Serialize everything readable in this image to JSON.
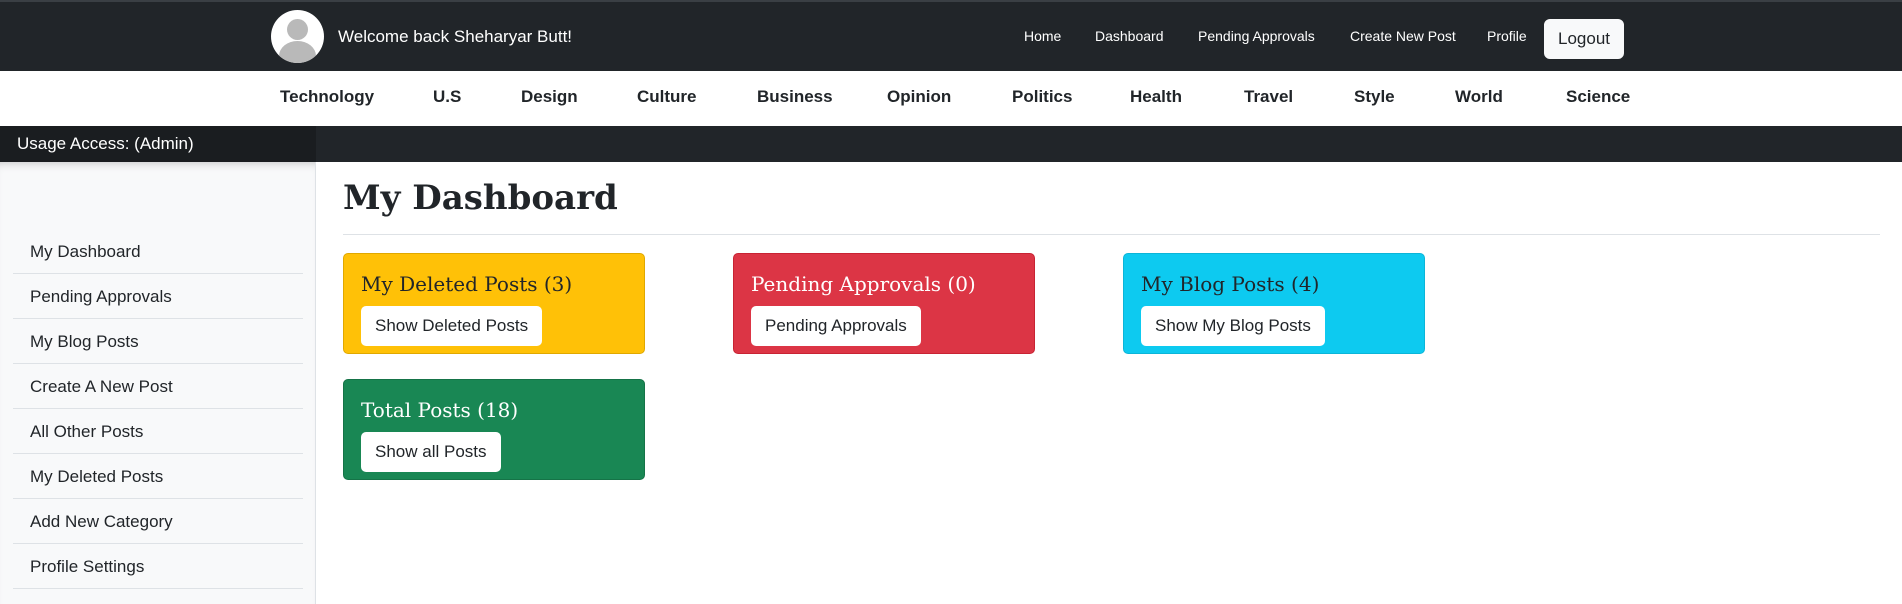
{
  "header": {
    "welcome": "Welcome back Sheharyar Butt!",
    "nav": [
      "Home",
      "Dashboard",
      "Pending Approvals",
      "Create New Post",
      "Profile"
    ],
    "logout": "Logout"
  },
  "categories": [
    "Technology",
    "U.S",
    "Design",
    "Culture",
    "Business",
    "Opinion",
    "Politics",
    "Health",
    "Travel",
    "Style",
    "World",
    "Science"
  ],
  "usage": "Usage Access: (Admin)",
  "sidebar": {
    "items": [
      {
        "label": "My Dashboard"
      },
      {
        "label": "Pending Approvals"
      },
      {
        "label": "My Blog Posts"
      },
      {
        "label": "Create A New Post"
      },
      {
        "label": "All Other Posts"
      },
      {
        "label": "My Deleted Posts"
      },
      {
        "label": "Add New Category"
      },
      {
        "label": "Profile Settings"
      }
    ]
  },
  "main": {
    "title": "My Dashboard",
    "cards": [
      {
        "title": "My Deleted Posts (3)",
        "button": "Show Deleted Posts",
        "color": "#ffc107"
      },
      {
        "title": "Pending Approvals (0)",
        "button": "Pending Approvals",
        "color": "#dc3545"
      },
      {
        "title": "My Blog Posts (4)",
        "button": "Show My Blog Posts",
        "color": "#0dcaf0"
      },
      {
        "title": "Total Posts (18)",
        "button": "Show all Posts",
        "color": "#198754"
      }
    ]
  },
  "colors": {
    "navbar": "#212529",
    "sidebar": "#f8f9fa",
    "warning": "#ffc107",
    "danger": "#dc3545",
    "info": "#0dcaf0",
    "success": "#198754"
  },
  "icons": {
    "avatar": "user-avatar-icon"
  }
}
